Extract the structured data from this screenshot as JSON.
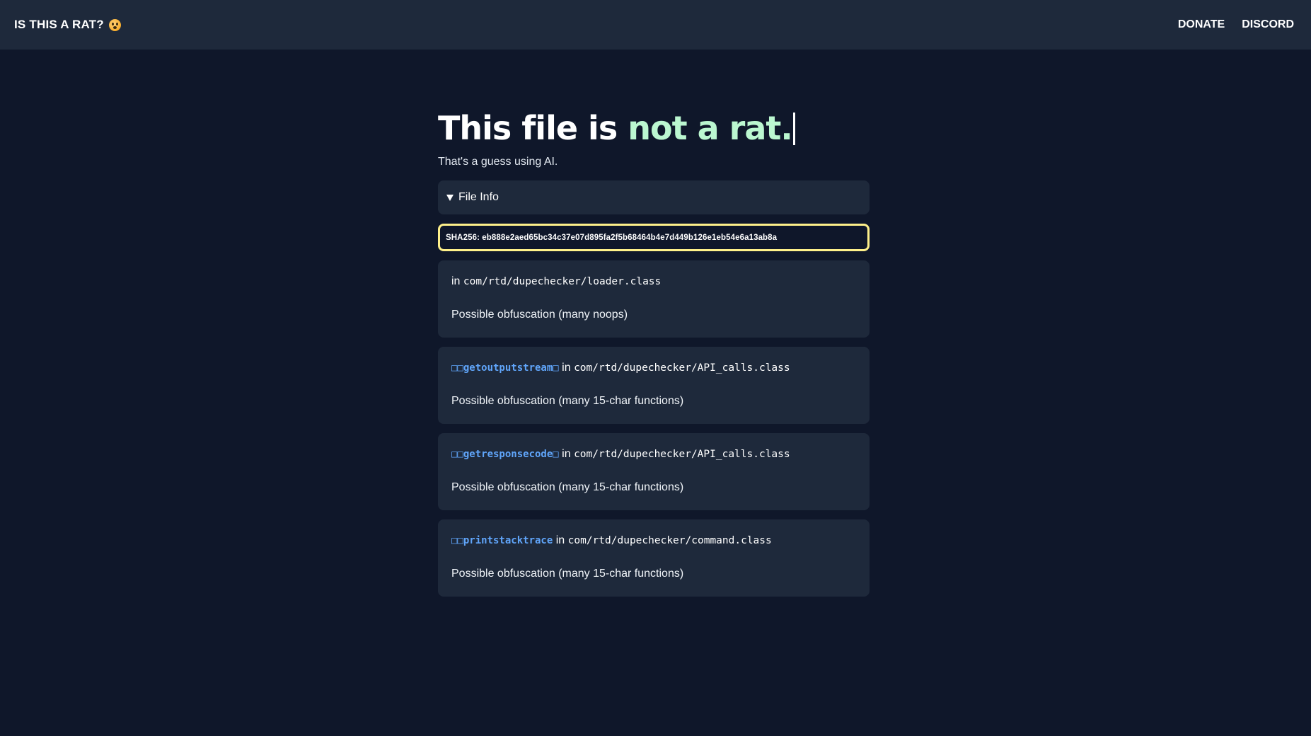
{
  "nav": {
    "brand": "IS THIS A RAT?",
    "brand_icon": "flushed-face-emoji",
    "links": [
      "DONATE",
      "DISCORD"
    ]
  },
  "hero": {
    "headline_prefix": "This file is ",
    "headline_accent": "not a rat.",
    "subtitle": "That's a guess using AI."
  },
  "file_info": {
    "label": "File Info",
    "expanded": true,
    "sha256": "SHA256: eb888e2aed65bc34c37e07d895fa2f5b68464b4e7d449b126e1eb54e6a13ab8a"
  },
  "findings": [
    {
      "func": "",
      "in_label": "in",
      "path": "com/rtd/dupechecker/loader.class",
      "description": "Possible obfuscation (many noops)"
    },
    {
      "func": "□□getoutputstream□",
      "in_label": "in",
      "path": "com/rtd/dupechecker/API_calls.class",
      "description": "Possible obfuscation (many 15-char functions)"
    },
    {
      "func": "□□getresponsecode□",
      "in_label": "in",
      "path": "com/rtd/dupechecker/API_calls.class",
      "description": "Possible obfuscation (many 15-char functions)"
    },
    {
      "func": "□□printstacktrace",
      "in_label": "in",
      "path": "com/rtd/dupechecker/command.class",
      "description": "Possible obfuscation (many 15-char functions)"
    }
  ],
  "colors": {
    "background": "#0f172a",
    "panel": "#1e293b",
    "accent_green": "#bbf7d0",
    "sha_border": "#fef08a",
    "func_link": "#60a5fa"
  }
}
